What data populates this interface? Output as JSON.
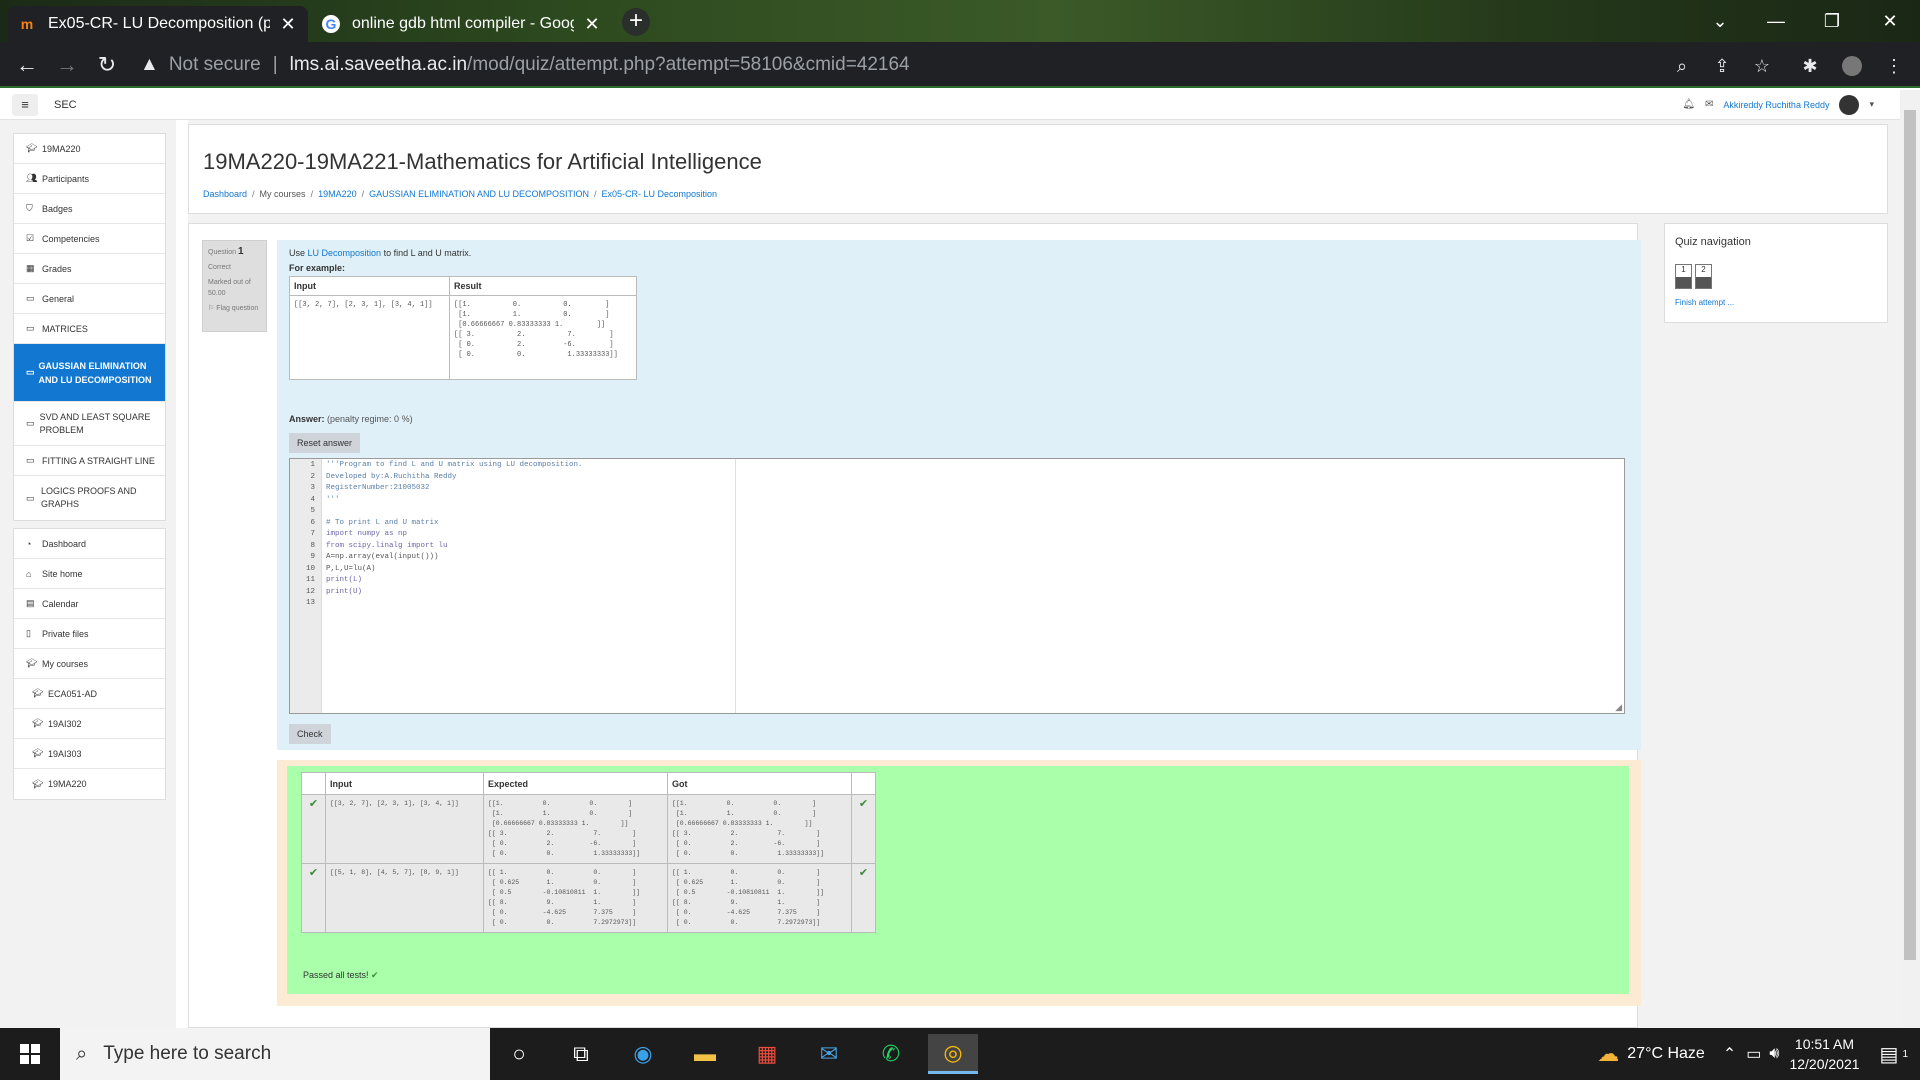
{
  "browser": {
    "tabs": [
      {
        "title": "Ex05-CR- LU Decomposition (pag",
        "icon": "moodle-icon",
        "active": true
      },
      {
        "title": "online gdb html compiler - Goog",
        "icon": "google-icon",
        "active": false
      }
    ],
    "new_tab": "+",
    "security": "Not secure",
    "url_host": "lms.ai.saveetha.ac.in",
    "url_path": "/mod/quiz/attempt.php?attempt=58106&cmid=42164"
  },
  "moodle": {
    "site_name": "SEC",
    "user_name": "Akkireddy Ruchitha Reddy",
    "drawer": {
      "group1": [
        {
          "icon": "graduation-cap-icon",
          "label": "19MA220"
        },
        {
          "icon": "users-icon",
          "label": "Participants"
        },
        {
          "icon": "shield-icon",
          "label": "Badges"
        },
        {
          "icon": "checkbox-icon",
          "label": "Competencies"
        },
        {
          "icon": "table-icon",
          "label": "Grades"
        },
        {
          "icon": "folder-icon",
          "label": "General"
        },
        {
          "icon": "folder-icon",
          "label": "MATRICES"
        },
        {
          "icon": "folder-icon",
          "label": "GAUSSIAN ELIMINATION AND LU DECOMPOSITION",
          "active": true
        },
        {
          "icon": "folder-icon",
          "label": "SVD AND LEAST SQUARE PROBLEM"
        },
        {
          "icon": "folder-icon",
          "label": "FITTING A STRAIGHT LINE"
        },
        {
          "icon": "folder-icon",
          "label": "LOGICS PROOFS AND GRAPHS"
        }
      ],
      "group2": [
        {
          "icon": "dashboard-icon",
          "label": "Dashboard"
        },
        {
          "icon": "home-icon",
          "label": "Site home"
        },
        {
          "icon": "calendar-icon",
          "label": "Calendar"
        },
        {
          "icon": "file-icon",
          "label": "Private files"
        },
        {
          "icon": "graduation-cap-icon",
          "label": "My courses"
        },
        {
          "icon": "graduation-cap-icon",
          "label": "ECA051-AD"
        },
        {
          "icon": "graduation-cap-icon",
          "label": "19AI302"
        },
        {
          "icon": "graduation-cap-icon",
          "label": "19AI303"
        },
        {
          "icon": "graduation-cap-icon",
          "label": "19MA220"
        }
      ]
    },
    "page_title": "19MA220-19MA221-Mathematics for Artificial Intelligence",
    "breadcrumb": [
      "Dashboard",
      "My courses",
      "19MA220",
      "GAUSSIAN ELIMINATION AND LU DECOMPOSITION",
      "Ex05-CR- LU Decomposition"
    ],
    "question": {
      "label": "Question",
      "number": "1",
      "status": "Correct",
      "marks": "Marked out of 50.00",
      "flag": "Flag question",
      "text_pre": "Use ",
      "text_link": "LU Decomposition",
      "text_post": " to find L and U matrix.",
      "for_example": "For example:",
      "example_headers": [
        "Input",
        "Result"
      ],
      "example_input": "[[3, 2, 7], [2, 3, 1], [3, 4, 1]]",
      "example_result": "[[1.          0.          0.        ]\n [1.          1.          0.        ]\n [0.66666667 0.83333333 1.        ]]\n[[ 3.          2.          7.        ]\n [ 0.          2.         -6.        ]\n [ 0.          0.          1.33333333]]",
      "answer_label": "Answer:",
      "penalty": "(penalty regime: 0 %)",
      "reset_button": "Reset answer",
      "check_button": "Check"
    },
    "code_lines": [
      "'''Program to find L and U matrix using LU decomposition.",
      "Developed by:A.Ruchitha Reddy",
      "RegisterNumber:21005032",
      "'''",
      "",
      "# To print L and U matrix",
      "import numpy as np",
      "from scipy.linalg import lu",
      "A=np.array(eval(input()))",
      "P,L,U=lu(A)",
      "print(L)",
      "print(U)",
      ""
    ],
    "results": {
      "headers": [
        "Input",
        "Expected",
        "Got"
      ],
      "rows": [
        {
          "input": "[[3, 2, 7], [2, 3, 1], [3, 4, 1]]",
          "expected": "[[1.          0.          0.        ]\n [1.          1.          0.        ]\n [0.66666667 0.83333333 1.        ]]\n[[ 3.          2.          7.        ]\n [ 0.          2.         -6.        ]\n [ 0.          0.          1.33333333]]",
          "got": "[[1.          0.          0.        ]\n [1.          1.          0.        ]\n [0.66666667 0.83333333 1.        ]]\n[[ 3.          2.          7.        ]\n [ 0.          2.         -6.        ]\n [ 0.          0.          1.33333333]]"
        },
        {
          "input": "[[5, 1, 8], [4, 5, 7], [8, 9, 1]]",
          "expected": "[[ 1.          0.          0.        ]\n [ 0.625       1.          0.        ]\n [ 0.5        -0.10810811  1.        ]]\n[[ 8.          9.          1.        ]\n [ 0.         -4.625       7.375     ]\n [ 0.          0.          7.2972973]]",
          "got": "[[ 1.          0.          0.        ]\n [ 0.625       1.          0.        ]\n [ 0.5        -0.10810811  1.        ]]\n[[ 8.          9.          1.        ]\n [ 0.         -4.625       7.375     ]\n [ 0.          0.          7.2972973]]"
        }
      ],
      "passed": "Passed all tests!"
    },
    "quiz_nav": {
      "title": "Quiz navigation",
      "buttons": [
        "1",
        "2"
      ],
      "finish": "Finish attempt ..."
    }
  },
  "taskbar": {
    "search_placeholder": "Type here to search",
    "weather": "27°C  Haze",
    "time": "10:51 AM",
    "date": "12/20/2021",
    "notifications": "1"
  }
}
